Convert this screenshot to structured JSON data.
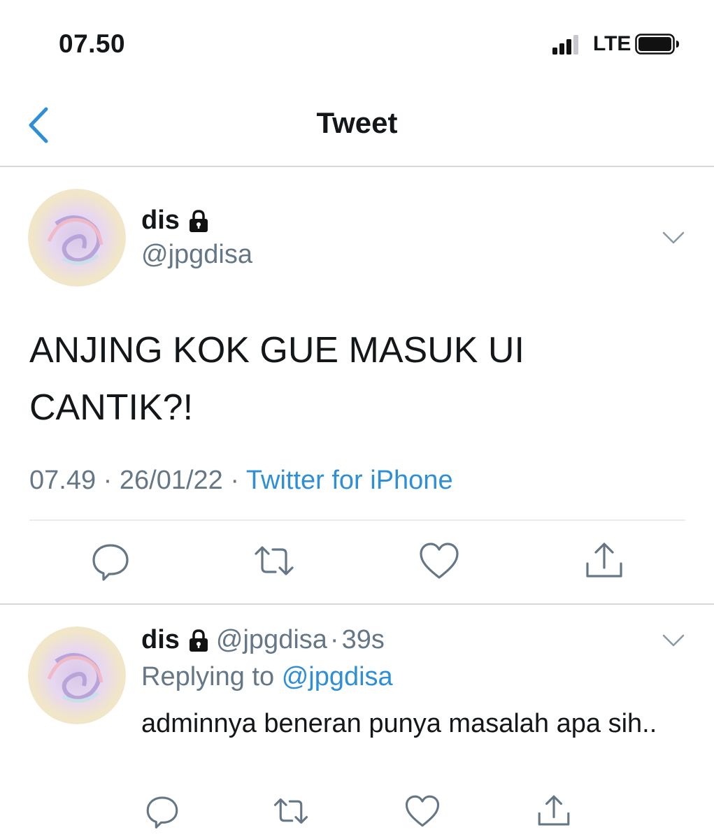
{
  "status_bar": {
    "time": "07.50",
    "network": "LTE",
    "icons": [
      "signal-icon",
      "battery-icon"
    ]
  },
  "nav": {
    "title": "Tweet",
    "back_icon": "chevron-left-icon"
  },
  "tweet": {
    "name": "dis",
    "handle": "@jpgdisa",
    "text": "ANJING KOK GUE MASUK UI CANTIK?!",
    "time": "07.49",
    "date": "26/01/22",
    "sep": "·",
    "source": "Twitter for iPhone",
    "actions": [
      "reply-icon",
      "retweet-icon",
      "like-icon",
      "share-icon"
    ]
  },
  "reply": {
    "name": "dis",
    "handle": "@jpgdisa",
    "age": "39s",
    "sep": "·",
    "replying_prefix": "Replying to",
    "replying_handle": "@jpgdisa",
    "text": "adminnya beneran punya masalah apa sih.."
  },
  "colors": {
    "accent": "#2e8fd6",
    "muted": "#657786",
    "text": "#14171a",
    "divider": "#d5d9dc"
  }
}
